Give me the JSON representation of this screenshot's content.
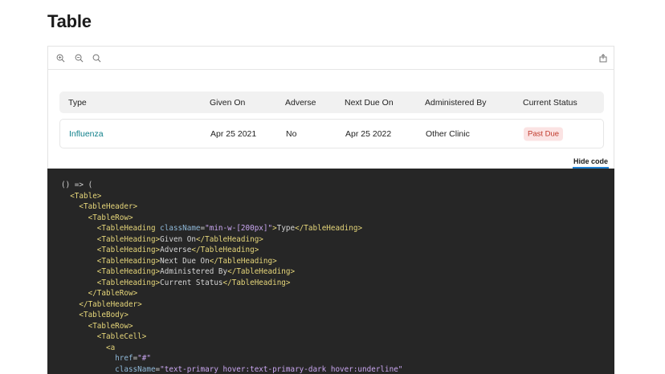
{
  "page": {
    "title": "Table"
  },
  "toolbar": {
    "icons": [
      "zoom-in-icon",
      "zoom-out-icon",
      "zoom-reset-icon",
      "share-icon"
    ]
  },
  "table": {
    "headers": [
      "Type",
      "Given On",
      "Adverse",
      "Next Due On",
      "Administered By",
      "Current Status"
    ],
    "rows": [
      {
        "type": "Influenza",
        "given_on": "Apr 25 2021",
        "adverse": "No",
        "next_due_on": "Apr 25 2022",
        "administered_by": "Other Clinic",
        "status": "Past Due"
      }
    ]
  },
  "hide_code_label": "Hide code",
  "colors": {
    "link": "#0e7f8a",
    "badge_bg": "#fbe3e3",
    "badge_text": "#c0392b",
    "code_bg": "#262626",
    "active_underline": "#1f7fd1"
  },
  "code_lines": [
    [
      {
        "t": "punc",
        "v": "() => ("
      }
    ],
    [
      {
        "t": "punc",
        "v": "  "
      },
      {
        "t": "tag",
        "v": "<Table>"
      }
    ],
    [
      {
        "t": "punc",
        "v": "    "
      },
      {
        "t": "tag",
        "v": "<TableHeader>"
      }
    ],
    [
      {
        "t": "punc",
        "v": "      "
      },
      {
        "t": "tag",
        "v": "<TableRow>"
      }
    ],
    [
      {
        "t": "punc",
        "v": "        "
      },
      {
        "t": "tag",
        "v": "<TableHeading "
      },
      {
        "t": "attr",
        "v": "className"
      },
      {
        "t": "punc",
        "v": "="
      },
      {
        "t": "str",
        "v": "\"min-w-[200px]\""
      },
      {
        "t": "tag",
        "v": ">"
      },
      {
        "t": "punc",
        "v": "Type"
      },
      {
        "t": "tag",
        "v": "</TableHeading>"
      }
    ],
    [
      {
        "t": "punc",
        "v": "        "
      },
      {
        "t": "tag",
        "v": "<TableHeading>"
      },
      {
        "t": "punc",
        "v": "Given On"
      },
      {
        "t": "tag",
        "v": "</TableHeading>"
      }
    ],
    [
      {
        "t": "punc",
        "v": "        "
      },
      {
        "t": "tag",
        "v": "<TableHeading>"
      },
      {
        "t": "punc",
        "v": "Adverse"
      },
      {
        "t": "tag",
        "v": "</TableHeading>"
      }
    ],
    [
      {
        "t": "punc",
        "v": "        "
      },
      {
        "t": "tag",
        "v": "<TableHeading>"
      },
      {
        "t": "punc",
        "v": "Next Due On"
      },
      {
        "t": "tag",
        "v": "</TableHeading>"
      }
    ],
    [
      {
        "t": "punc",
        "v": "        "
      },
      {
        "t": "tag",
        "v": "<TableHeading>"
      },
      {
        "t": "punc",
        "v": "Administered By"
      },
      {
        "t": "tag",
        "v": "</TableHeading>"
      }
    ],
    [
      {
        "t": "punc",
        "v": "        "
      },
      {
        "t": "tag",
        "v": "<TableHeading>"
      },
      {
        "t": "punc",
        "v": "Current Status"
      },
      {
        "t": "tag",
        "v": "</TableHeading>"
      }
    ],
    [
      {
        "t": "punc",
        "v": "      "
      },
      {
        "t": "tag",
        "v": "</TableRow>"
      }
    ],
    [
      {
        "t": "punc",
        "v": "    "
      },
      {
        "t": "tag",
        "v": "</TableHeader>"
      }
    ],
    [
      {
        "t": "punc",
        "v": "    "
      },
      {
        "t": "tag",
        "v": "<TableBody>"
      }
    ],
    [
      {
        "t": "punc",
        "v": "      "
      },
      {
        "t": "tag",
        "v": "<TableRow>"
      }
    ],
    [
      {
        "t": "punc",
        "v": "        "
      },
      {
        "t": "tag",
        "v": "<TableCell>"
      }
    ],
    [
      {
        "t": "punc",
        "v": "          "
      },
      {
        "t": "tag",
        "v": "<a"
      }
    ],
    [
      {
        "t": "punc",
        "v": "            "
      },
      {
        "t": "attr",
        "v": "href"
      },
      {
        "t": "punc",
        "v": "="
      },
      {
        "t": "str",
        "v": "\"#\""
      }
    ],
    [
      {
        "t": "punc",
        "v": "            "
      },
      {
        "t": "attr",
        "v": "className"
      },
      {
        "t": "punc",
        "v": "="
      },
      {
        "t": "str",
        "v": "\"text-primary hover:text-primary-dark hover:underline\""
      }
    ]
  ]
}
